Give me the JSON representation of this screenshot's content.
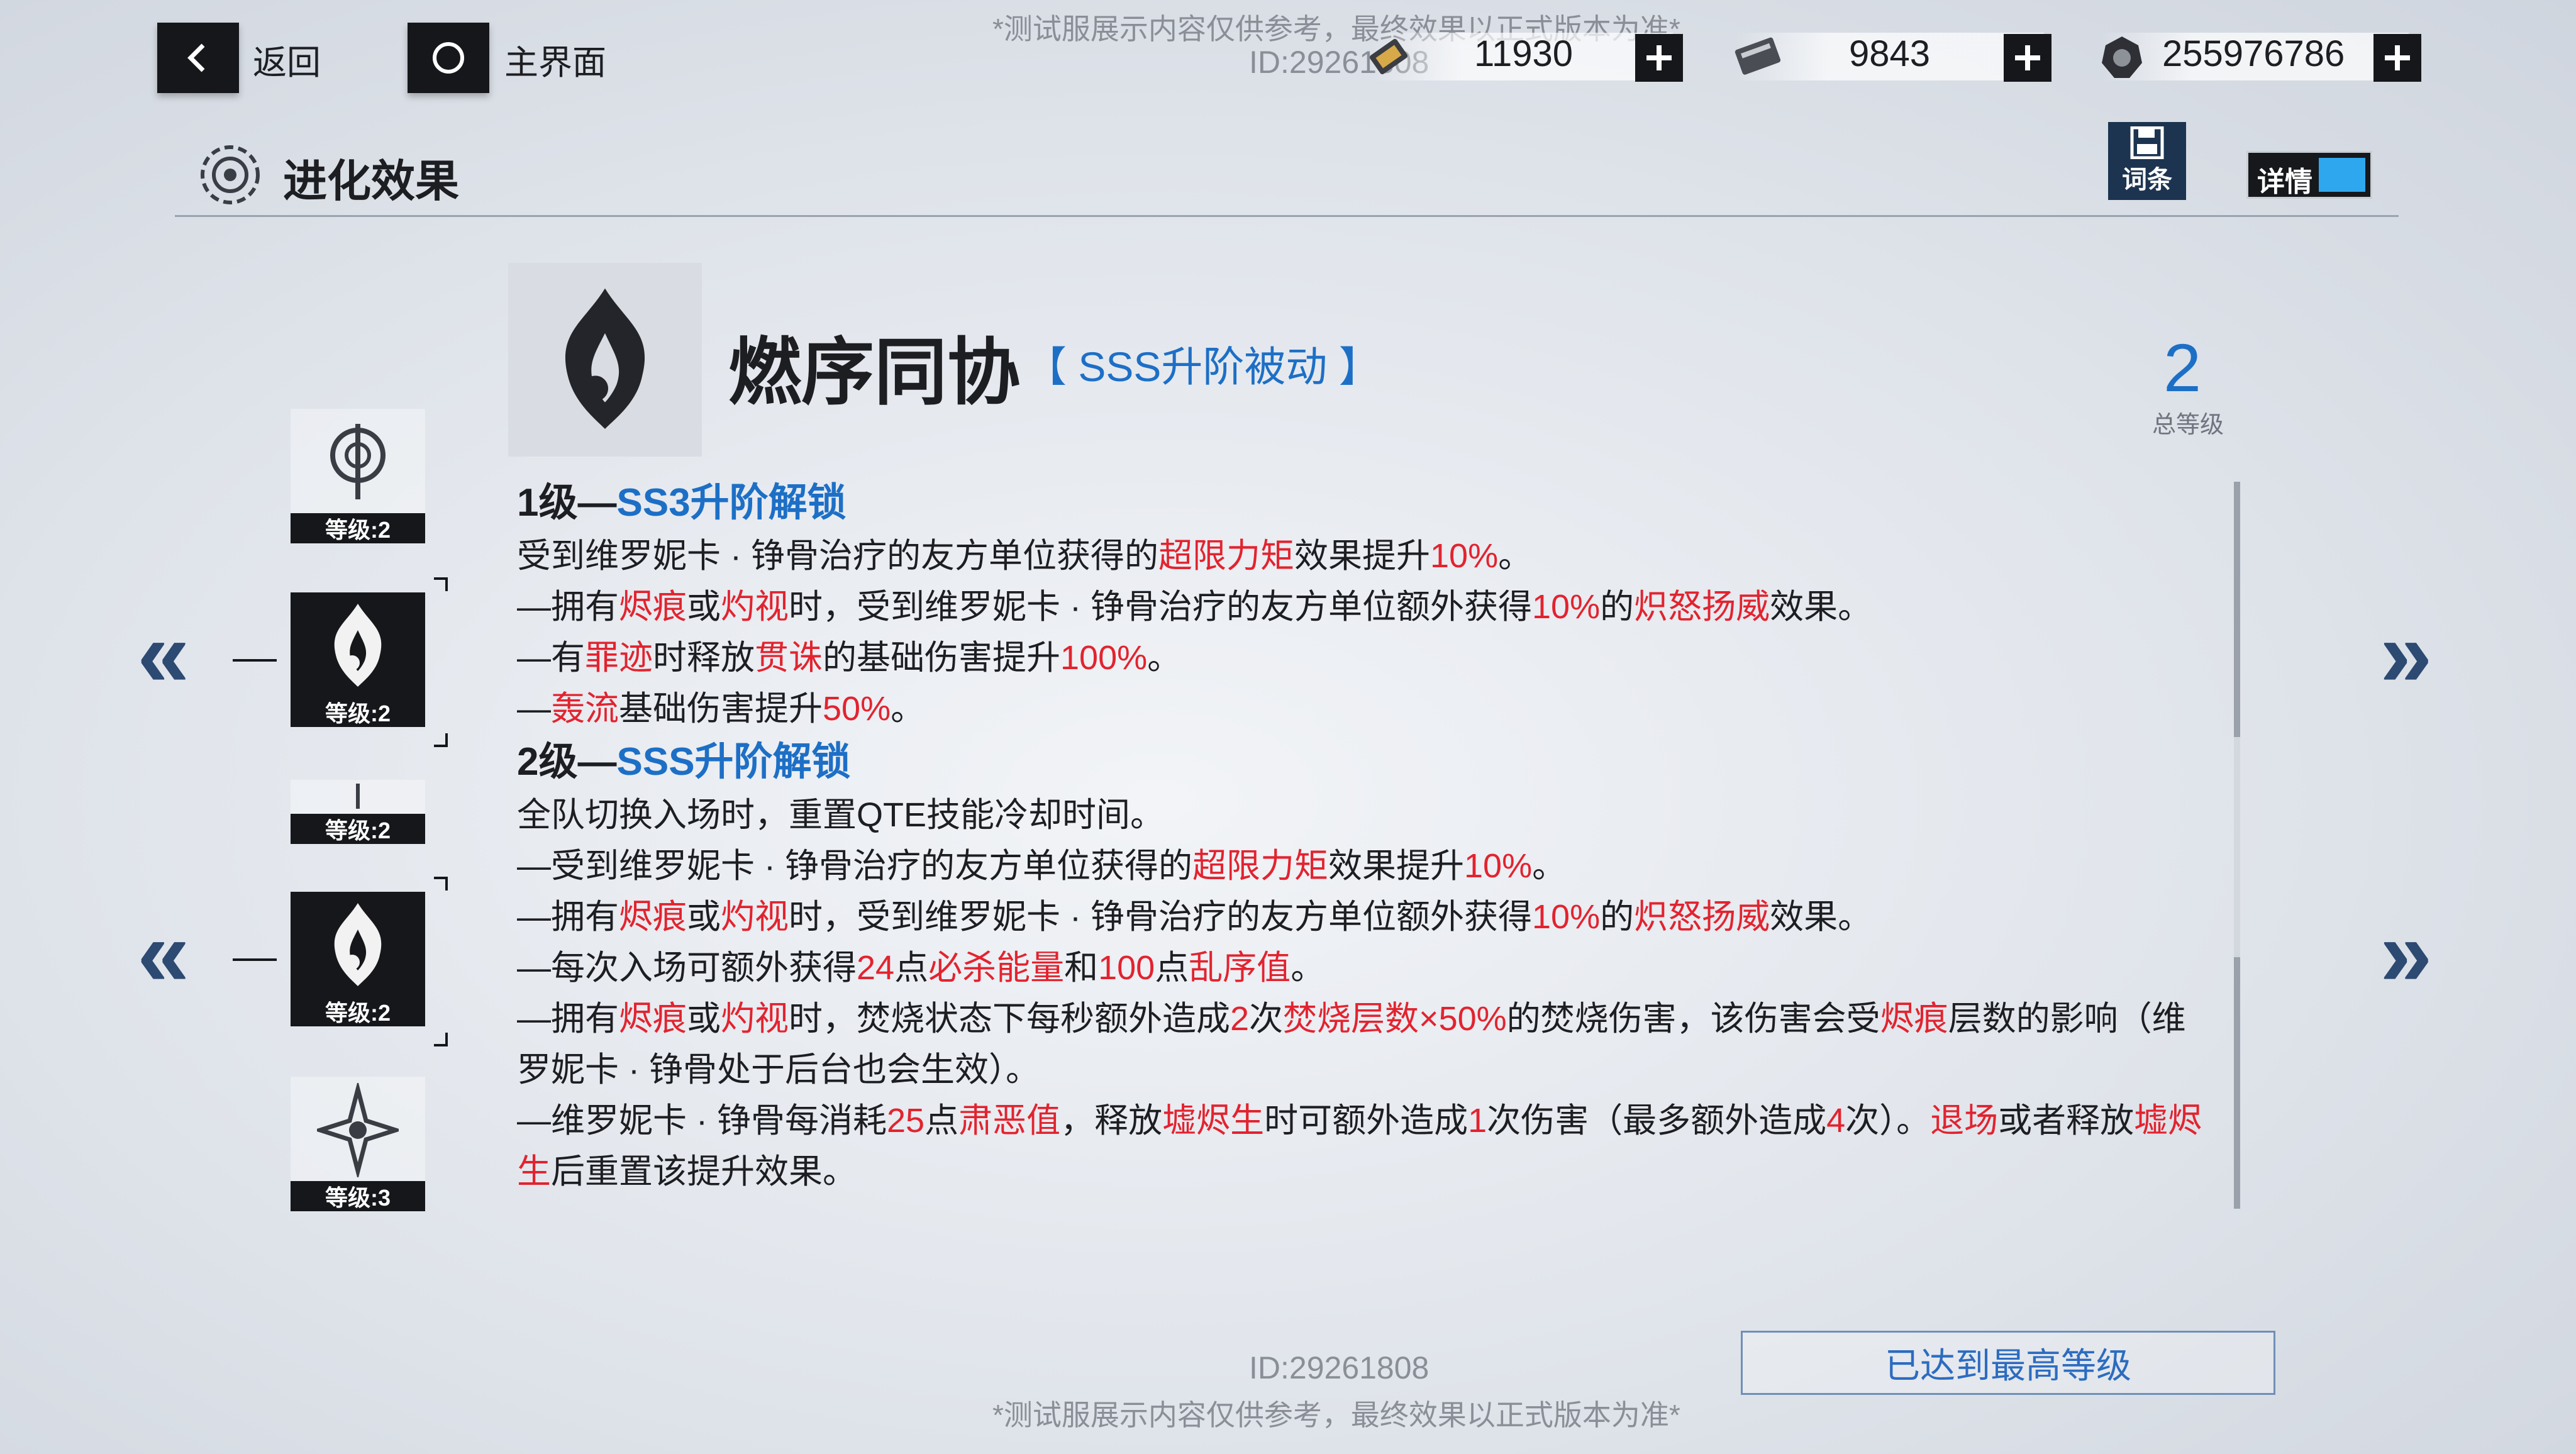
{
  "watermark": {
    "notice": "*测试服展示内容仅供参考，最终效果以正式版本为准*",
    "id": "ID:29261808"
  },
  "topbar": {
    "back_label": "返回",
    "home_label": "主界面",
    "resources": [
      {
        "icon": "ticket-icon",
        "value": "11930"
      },
      {
        "icon": "card-icon",
        "value": "9843"
      },
      {
        "icon": "gear-coin-icon",
        "value": "255976786"
      }
    ]
  },
  "header": {
    "title": "进化效果",
    "term_button": "词条",
    "detail_toggle": "详情"
  },
  "left_list": [
    {
      "level_text": "等级:2",
      "icon": "target-sword-icon",
      "selected": false
    },
    {
      "level_text": "等级:2",
      "icon": "flame-emblem-icon",
      "selected": true
    },
    {
      "level_text": "等级:2",
      "icon": "sword-icon",
      "selected": false
    },
    {
      "level_text": "等级:2",
      "icon": "flame-emblem-icon",
      "selected": true
    },
    {
      "level_text": "等级:3",
      "icon": "star-compass-icon",
      "selected": false
    }
  ],
  "skill": {
    "name": "燃序同协",
    "tag": "【 SSS升阶被动 】",
    "total_level": "2",
    "total_level_label": "总等级"
  },
  "levels": [
    {
      "heading_prefix": "1级—",
      "heading_rank": "SS3升阶解锁",
      "lines": [
        [
          [
            "受到维罗妮卡 · 铮骨治疗的友方单位获得的",
            ""
          ],
          [
            "超限力矩",
            "r"
          ],
          [
            "效果提升",
            ""
          ],
          [
            "10%",
            "r"
          ],
          [
            "。",
            ""
          ]
        ],
        [
          [
            "—拥有",
            ""
          ],
          [
            "烬痕",
            "r"
          ],
          [
            "或",
            ""
          ],
          [
            "灼视",
            "r"
          ],
          [
            "时，受到维罗妮卡 · 铮骨治疗的友方单位额外获得",
            ""
          ],
          [
            "10%",
            "r"
          ],
          [
            "的",
            ""
          ],
          [
            "炽怒扬威",
            "r"
          ],
          [
            "效果。",
            ""
          ]
        ],
        [
          [
            "—有",
            ""
          ],
          [
            "罪迹",
            "r"
          ],
          [
            "时释放",
            ""
          ],
          [
            "贯诛",
            "r"
          ],
          [
            "的基础伤害提升",
            ""
          ],
          [
            "100%",
            "r"
          ],
          [
            "。",
            ""
          ]
        ],
        [
          [
            "—",
            ""
          ],
          [
            "轰流",
            "r"
          ],
          [
            "基础伤害提升",
            ""
          ],
          [
            "50%",
            "r"
          ],
          [
            "。",
            ""
          ]
        ]
      ]
    },
    {
      "heading_prefix": "2级—",
      "heading_rank": "SSS升阶解锁",
      "lines": [
        [
          [
            "全队切换入场时，重置QTE技能冷却时间。",
            ""
          ]
        ],
        [
          [
            "—受到维罗妮卡 · 铮骨治疗的友方单位获得的",
            ""
          ],
          [
            "超限力矩",
            "r"
          ],
          [
            "效果提升",
            ""
          ],
          [
            "10%",
            "r"
          ],
          [
            "。",
            ""
          ]
        ],
        [
          [
            "—拥有",
            ""
          ],
          [
            "烬痕",
            "r"
          ],
          [
            "或",
            ""
          ],
          [
            "灼视",
            "r"
          ],
          [
            "时，受到维罗妮卡 · 铮骨治疗的友方单位额外获得",
            ""
          ],
          [
            "10%",
            "r"
          ],
          [
            "的",
            ""
          ],
          [
            "炽怒扬威",
            "r"
          ],
          [
            "效果。",
            ""
          ]
        ],
        [
          [
            "—每次入场可额外获得",
            ""
          ],
          [
            "24",
            "r"
          ],
          [
            "点",
            ""
          ],
          [
            "必杀能量",
            "r"
          ],
          [
            "和",
            ""
          ],
          [
            "100",
            "r"
          ],
          [
            "点",
            ""
          ],
          [
            "乱序值",
            "r"
          ],
          [
            "。",
            ""
          ]
        ],
        [
          [
            "—拥有",
            ""
          ],
          [
            "烬痕",
            "r"
          ],
          [
            "或",
            ""
          ],
          [
            "灼视",
            "r"
          ],
          [
            "时，焚烧状态下每秒额外造成",
            ""
          ],
          [
            "2",
            "r"
          ],
          [
            "次",
            ""
          ],
          [
            "焚烧层数×50%",
            "r"
          ],
          [
            "的焚烧伤害，该伤害会受",
            ""
          ],
          [
            "烬痕",
            "r"
          ],
          [
            "层数的影响（维罗妮卡 · 铮骨处于后台也会生效）。",
            ""
          ]
        ],
        [
          [
            "—维罗妮卡 · 铮骨每消耗",
            ""
          ],
          [
            "25",
            "r"
          ],
          [
            "点",
            ""
          ],
          [
            "肃恶值",
            "r"
          ],
          [
            "，释放",
            ""
          ],
          [
            "墟烬生",
            "r"
          ],
          [
            "时可额外造成",
            ""
          ],
          [
            "1",
            "r"
          ],
          [
            "次伤害（最多额外造成",
            ""
          ],
          [
            "4",
            "r"
          ],
          [
            "次）。",
            ""
          ],
          [
            "退场",
            "r"
          ],
          [
            "或者释放",
            ""
          ],
          [
            "墟烬生",
            "r"
          ],
          [
            "后重置该提升效果。",
            ""
          ]
        ]
      ]
    }
  ],
  "footer": {
    "max_level_button": "已达到最高等级"
  },
  "colors": {
    "highlight_red": "#e2232f",
    "accent_blue": "#1d6fc6",
    "dark": "#15171b"
  }
}
